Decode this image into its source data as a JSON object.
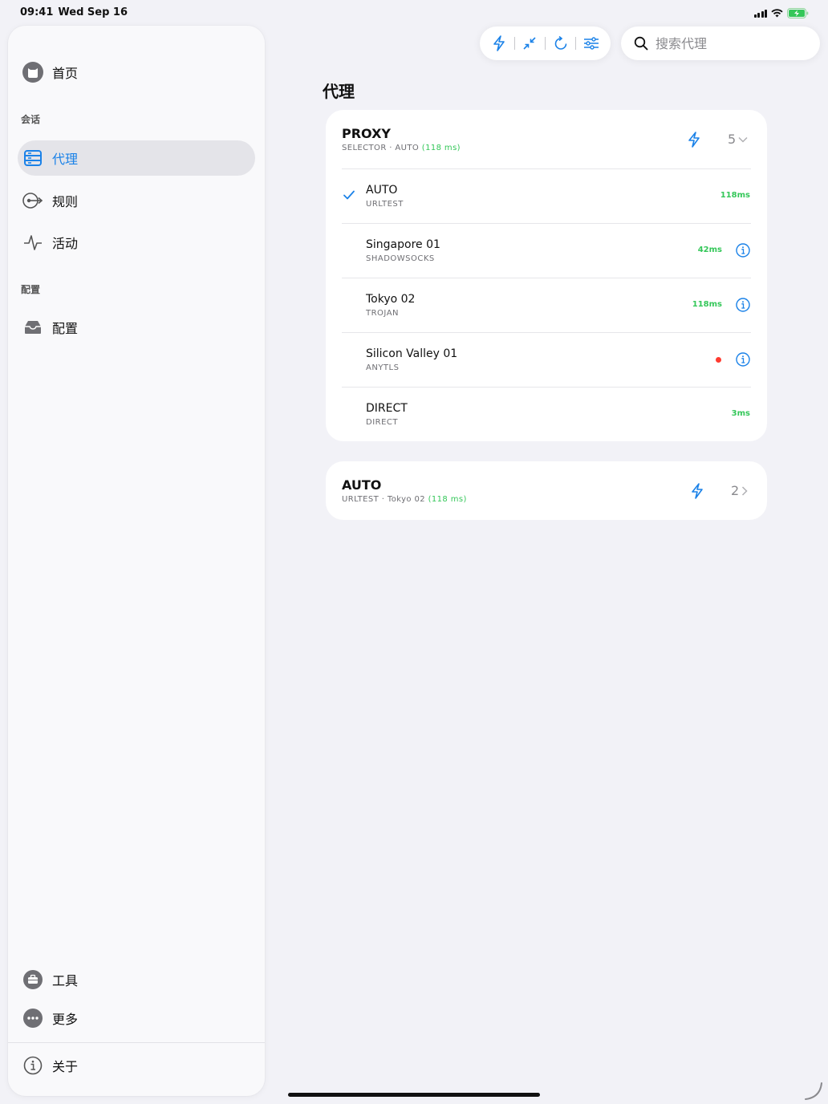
{
  "status": {
    "time": "09:41",
    "date": "Wed Sep 16"
  },
  "sidebar": {
    "home_label": "首页",
    "section_session": "会话",
    "items": [
      {
        "label": "代理",
        "icon": "server-stack-icon",
        "active": true
      },
      {
        "label": "规则",
        "icon": "route-icon",
        "active": false
      },
      {
        "label": "活动",
        "icon": "waveform-icon",
        "active": false
      }
    ],
    "section_config": "配置",
    "config_label": "配置",
    "tools_label": "工具",
    "more_label": "更多",
    "about_label": "关于"
  },
  "toolbar": {
    "buttons": [
      "bolt-icon",
      "collapse-arrows-icon",
      "refresh-icon",
      "sliders-icon"
    ]
  },
  "search": {
    "placeholder": "搜索代理"
  },
  "main": {
    "title": "代理",
    "groups": [
      {
        "name": "PROXY",
        "type": "SELECTOR",
        "selected": "AUTO",
        "selected_latency": "(118 ms)",
        "count": "5",
        "expanded": true,
        "items": [
          {
            "name": "AUTO",
            "type": "URLTEST",
            "latency": "118ms",
            "selected": true,
            "info": false
          },
          {
            "name": "Singapore 01",
            "type": "SHADOWSOCKS",
            "latency": "42ms",
            "selected": false,
            "info": true
          },
          {
            "name": "Tokyo 02",
            "type": "TROJAN",
            "latency": "118ms",
            "selected": false,
            "info": true
          },
          {
            "name": "Silicon Valley 01",
            "type": "ANYTLS",
            "latency": "",
            "status": "error",
            "selected": false,
            "info": true
          },
          {
            "name": "DIRECT",
            "type": "DIRECT",
            "latency": "3ms",
            "selected": false,
            "info": false
          }
        ]
      },
      {
        "name": "AUTO",
        "type": "URLTEST",
        "selected": "Tokyo 02",
        "selected_latency": "(118 ms)",
        "count": "2",
        "expanded": false
      }
    ]
  },
  "colors": {
    "accent": "#1b82e8",
    "latency_good": "#34c759",
    "error": "#ff3b30",
    "background": "#f2f2f7"
  }
}
